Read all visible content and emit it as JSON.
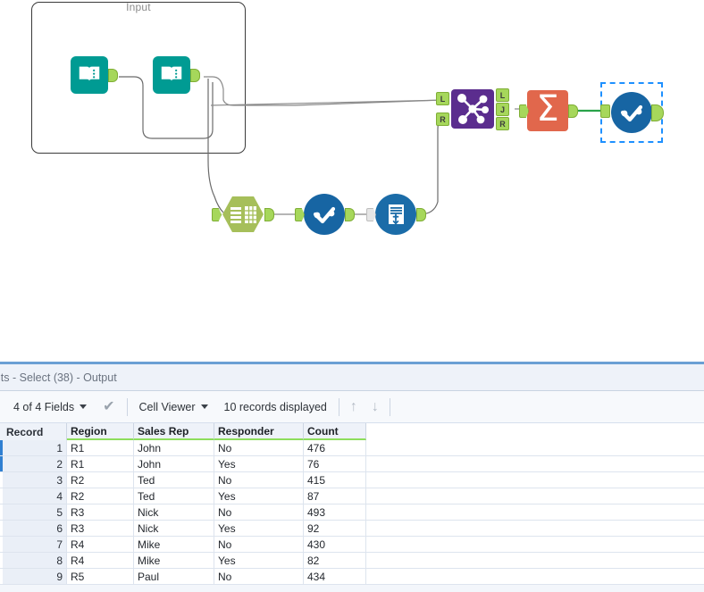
{
  "canvas": {
    "container": {
      "label": "Input"
    },
    "tools": [
      {
        "id": "input-1",
        "name": "input-data-tool",
        "type": "input-data",
        "icon": "book-icon"
      },
      {
        "id": "input-2",
        "name": "input-data-tool",
        "type": "input-data",
        "icon": "book-icon"
      },
      {
        "id": "select-1",
        "name": "select-tool",
        "type": "select",
        "icon": "table-grid-icon"
      },
      {
        "id": "browse-1",
        "name": "browse-tool",
        "type": "browse",
        "icon": "browse-eye-icon"
      },
      {
        "id": "union-1",
        "name": "union-tool",
        "type": "union",
        "icon": "document-plus-down-icon"
      },
      {
        "id": "join-1",
        "name": "join-tool",
        "type": "join",
        "icon": "join-nodes-icon"
      },
      {
        "id": "summarize-1",
        "name": "summarize-tool",
        "type": "summarize",
        "icon": "sigma-icon"
      },
      {
        "id": "browse-2",
        "name": "browse-tool-selected",
        "type": "browse",
        "icon": "browse-eye-icon",
        "selected": true
      }
    ],
    "join_ports": {
      "in_left": "L",
      "in_right": "R",
      "out_left": "L",
      "out_join": "J",
      "out_right": "R"
    },
    "summarize_symbol": "Σ"
  },
  "results": {
    "title": "lts - Select (38) - Output",
    "toolbar": {
      "fields_label": "4 of 4 Fields",
      "check_icon": "✔",
      "viewer_label": "Cell Viewer",
      "records_label": "10 records displayed",
      "up_icon": "↑",
      "down_icon": "↓"
    },
    "table": {
      "columns": [
        "Record",
        "Region",
        "Sales Rep",
        "Responder",
        "Count"
      ],
      "rows": [
        {
          "record": "1",
          "region": "R1",
          "rep": "John",
          "responder": "No",
          "count": "476",
          "marked": true
        },
        {
          "record": "2",
          "region": "R1",
          "rep": "John",
          "responder": "Yes",
          "count": "76",
          "marked": true
        },
        {
          "record": "3",
          "region": "R2",
          "rep": "Ted",
          "responder": "No",
          "count": "415",
          "marked": false
        },
        {
          "record": "4",
          "region": "R2",
          "rep": "Ted",
          "responder": "Yes",
          "count": "87",
          "marked": false
        },
        {
          "record": "5",
          "region": "R3",
          "rep": "Nick",
          "responder": "No",
          "count": "493",
          "marked": false
        },
        {
          "record": "6",
          "region": "R3",
          "rep": "Nick",
          "responder": "Yes",
          "count": "92",
          "marked": false
        },
        {
          "record": "7",
          "region": "R4",
          "rep": "Mike",
          "responder": "No",
          "count": "430",
          "marked": false
        },
        {
          "record": "8",
          "region": "R4",
          "rep": "Mike",
          "responder": "Yes",
          "count": "82",
          "marked": false
        },
        {
          "record": "9",
          "region": "R5",
          "rep": "Paul",
          "responder": "No",
          "count": "434",
          "marked": false
        }
      ]
    }
  },
  "colors": {
    "input_teal": "#009b93",
    "select_green": "#a6bf5a",
    "browse_blue": "#1765a3",
    "join_purple": "#5b2d8e",
    "summarize_orange": "#e1674c",
    "port_green": "#a6d75b",
    "selection_blue": "#1e90ff",
    "header_underline": "#8ede5c"
  }
}
